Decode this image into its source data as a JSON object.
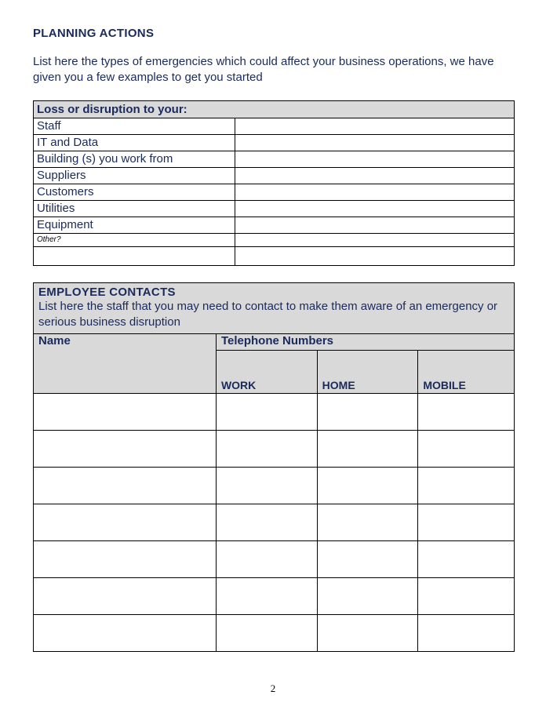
{
  "section_title": "PLANNING ACTIONS",
  "intro": "List here the types of emergencies which could affect your business operations, we have given you a few examples to get you started",
  "table1": {
    "header": "Loss or disruption to your:",
    "rows": [
      "Staff",
      "IT and Data",
      "Building (s) you work from",
      "Suppliers",
      "Customers",
      "Utilities",
      "Equipment"
    ],
    "other_label": "Other?"
  },
  "table2": {
    "title": "EMPLOYEE CONTACTS",
    "desc": "List here the staff that you may need to contact to make them aware of an emergency or serious business disruption",
    "col_name": "Name",
    "col_phone": "Telephone Numbers",
    "sub_work": "WORK",
    "sub_home": "HOME",
    "sub_mobile": "MOBILE",
    "row_count": 7
  },
  "page_number": "2"
}
